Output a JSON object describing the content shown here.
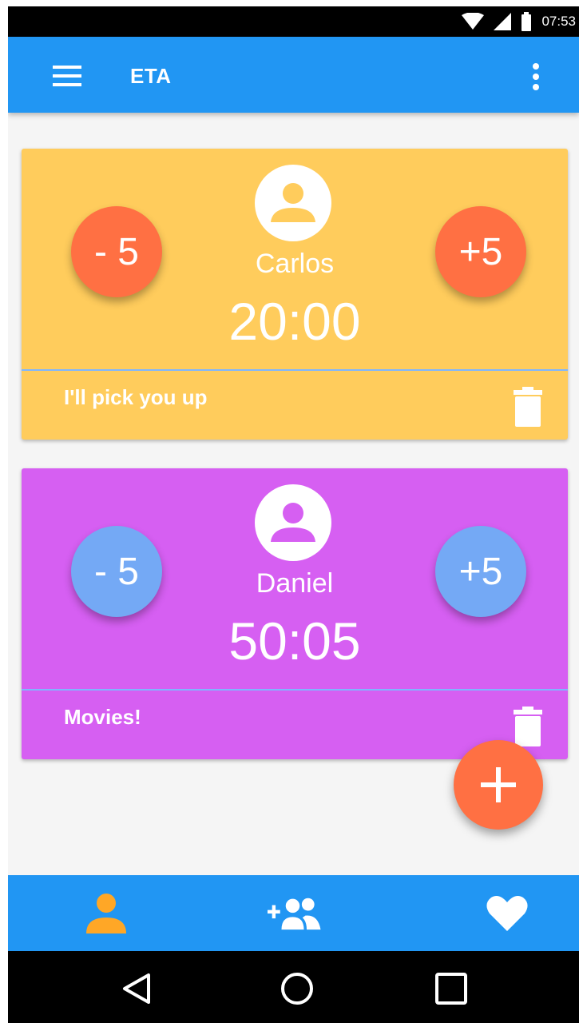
{
  "status_bar": {
    "time": "07:53"
  },
  "app_bar": {
    "title": "ETA",
    "menu_icon": "hamburger-icon",
    "more_icon": "more-vert-icon"
  },
  "cards": [
    {
      "name": "Carlos",
      "time": "20:00",
      "minus_label": "- 5",
      "plus_label": "+5",
      "note": "I'll pick you up",
      "background": "#ffcc5c",
      "button_color": "#ff7043"
    },
    {
      "name": "Daniel",
      "time": "50:05",
      "minus_label": "- 5",
      "plus_label": "+5",
      "note": "Movies!",
      "background": "#d65ff2",
      "button_color": "#74a9f5"
    }
  ],
  "fab": {
    "icon": "add-icon",
    "color": "#ff7043"
  },
  "bottom_nav": {
    "items": [
      {
        "icon": "person-icon",
        "active": true
      },
      {
        "icon": "add-group-icon",
        "active": false
      },
      {
        "icon": "heart-icon",
        "active": false
      }
    ],
    "background": "#2196f3",
    "active_color": "#ffa726"
  },
  "system_nav": [
    "back-icon",
    "home-icon",
    "recents-icon"
  ]
}
